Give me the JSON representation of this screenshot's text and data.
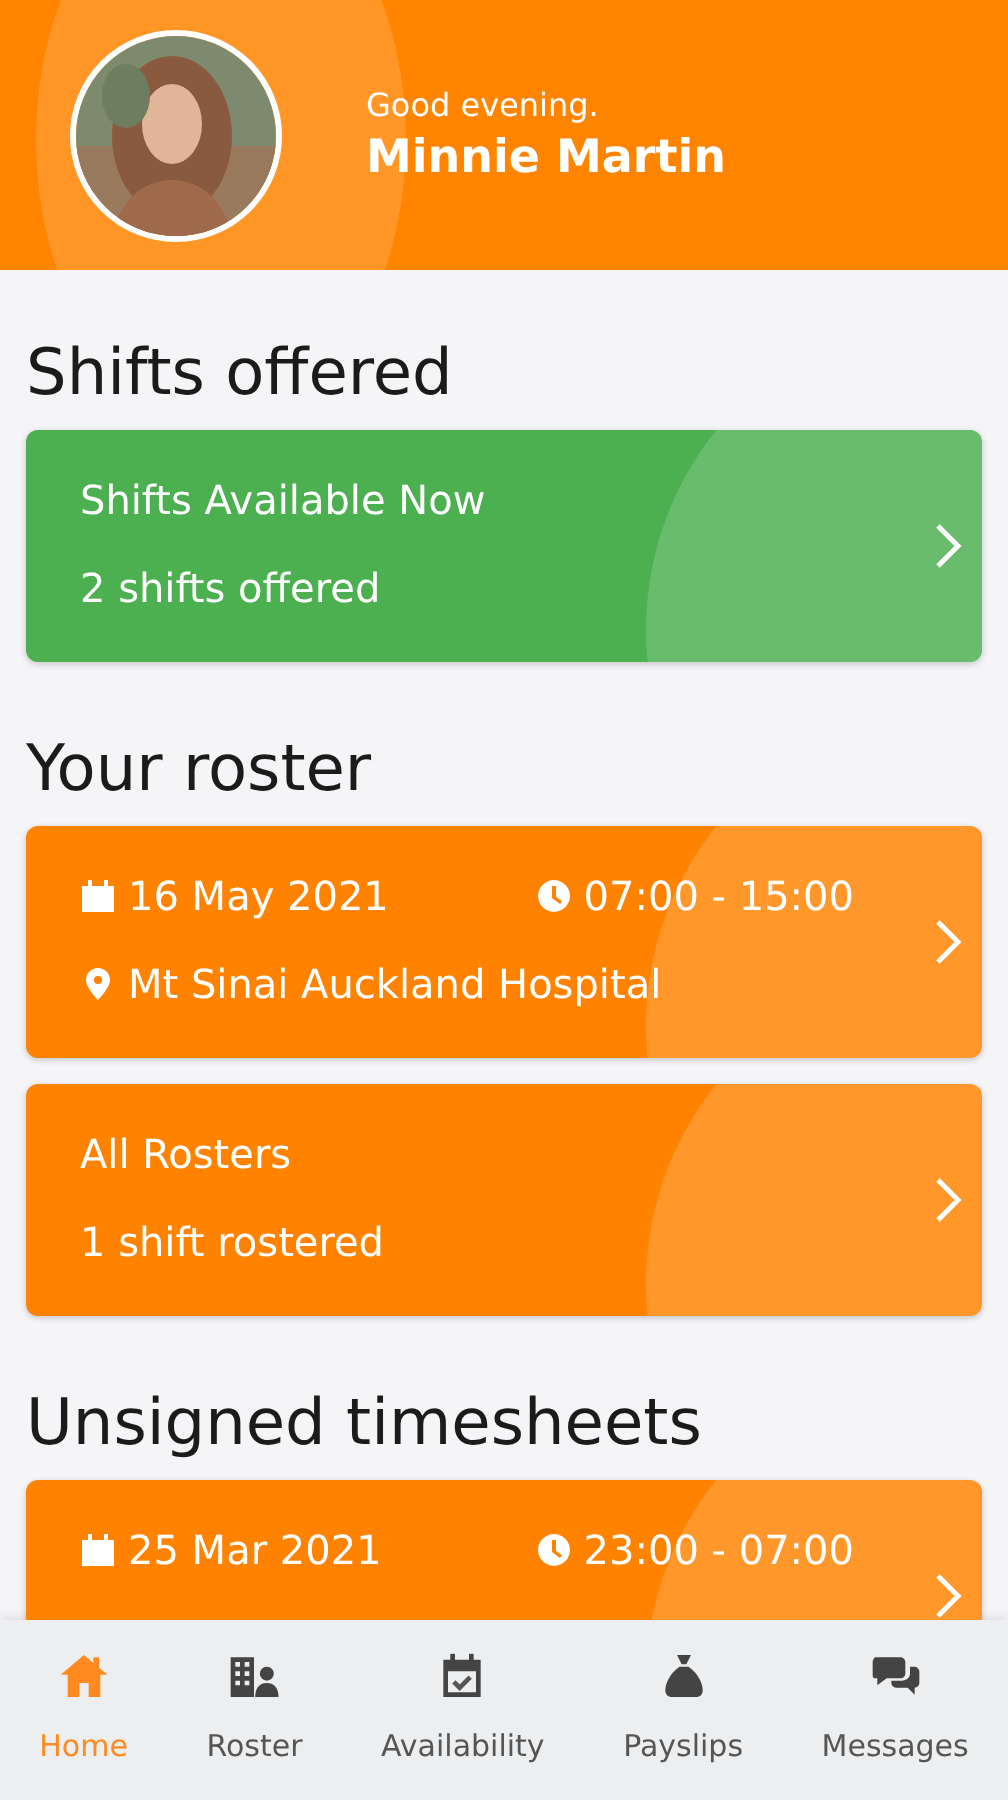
{
  "header": {
    "greeting": "Good evening.",
    "name": "Minnie Martin"
  },
  "sections": [
    {
      "title": "Shifts offered",
      "cards": [
        {
          "kind": "summary",
          "color": "#4caf50",
          "title": "Shifts Available Now",
          "subtitle": "2 shifts offered"
        }
      ]
    },
    {
      "title": "Your roster",
      "cards": [
        {
          "kind": "shift",
          "color": "#ff8200",
          "date": "16 May 2021",
          "time": "07:00 - 15:00",
          "location": "Mt Sinai Auckland Hospital"
        },
        {
          "kind": "summary",
          "color": "#ff8200",
          "title": "All Rosters",
          "subtitle": "1 shift rostered"
        }
      ]
    },
    {
      "title": "Unsigned timesheets",
      "cards": [
        {
          "kind": "shift",
          "color": "#ff8200",
          "date": "25 Mar 2021",
          "time": "23:00 - 07:00"
        }
      ]
    }
  ],
  "nav": [
    {
      "label": "Home",
      "selected": true
    },
    {
      "label": "Roster",
      "selected": false
    },
    {
      "label": "Availability",
      "selected": false
    },
    {
      "label": "Payslips",
      "selected": false
    },
    {
      "label": "Messages",
      "selected": false
    }
  ]
}
